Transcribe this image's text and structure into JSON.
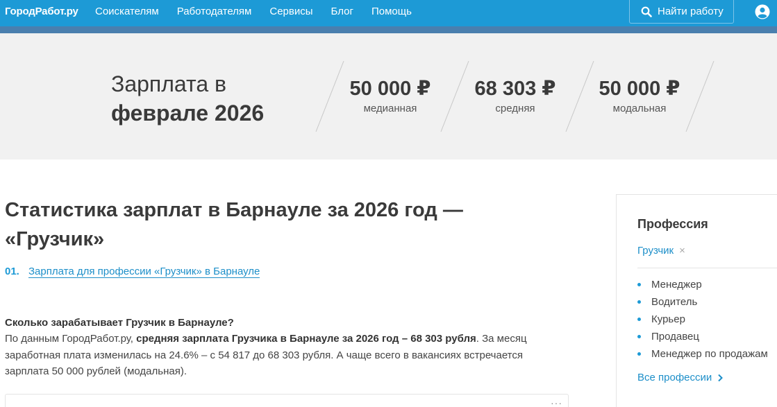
{
  "header": {
    "logo": "ГородРабот.ру",
    "nav": [
      "Соискателям",
      "Работодателям",
      "Сервисы",
      "Блог",
      "Помощь"
    ],
    "find_button": "Найти работу"
  },
  "hero": {
    "title_line1": "Зарплата в",
    "title_line2": "феврале 2026",
    "stats": [
      {
        "value": "50 000 ₽",
        "label": "медианная"
      },
      {
        "value": "68 303 ₽",
        "label": "средняя"
      },
      {
        "value": "50 000 ₽",
        "label": "модальная"
      }
    ]
  },
  "main": {
    "heading": "Статистика зарплат в Барнауле за 2026 год — «Грузчик»",
    "toc": [
      {
        "num": "01.",
        "label": "Зарплата для профессии «Грузчик» в Барнауле"
      }
    ],
    "question": "Сколько зарабатывает Грузчик в Барнауле?",
    "para_intro": "По данным ГородРабот.ру, ",
    "para_bold": "средняя зарплата Грузчика в Барнауле за 2026 год – 68 303 рубля",
    "para_rest": ". За месяц заработная плата изменилась на 24.6% – с 54 817 до 68 303 рубля. А чаще всего в вакансиях встречается зарплата 50 000 рублей (модальная).",
    "card_menu": "···"
  },
  "sidebar": {
    "title": "Профессия",
    "selected": "Грузчик",
    "remove": "×",
    "items": [
      "Менеджер",
      "Водитель",
      "Курьер",
      "Продавец",
      "Менеджер по продажам"
    ],
    "all_link": "Все профессии"
  },
  "colors": {
    "brand": "#1d9ad6",
    "stripe": "#4a7fae",
    "hero_bg": "#f1f1f1",
    "link": "#1d8fc9"
  }
}
